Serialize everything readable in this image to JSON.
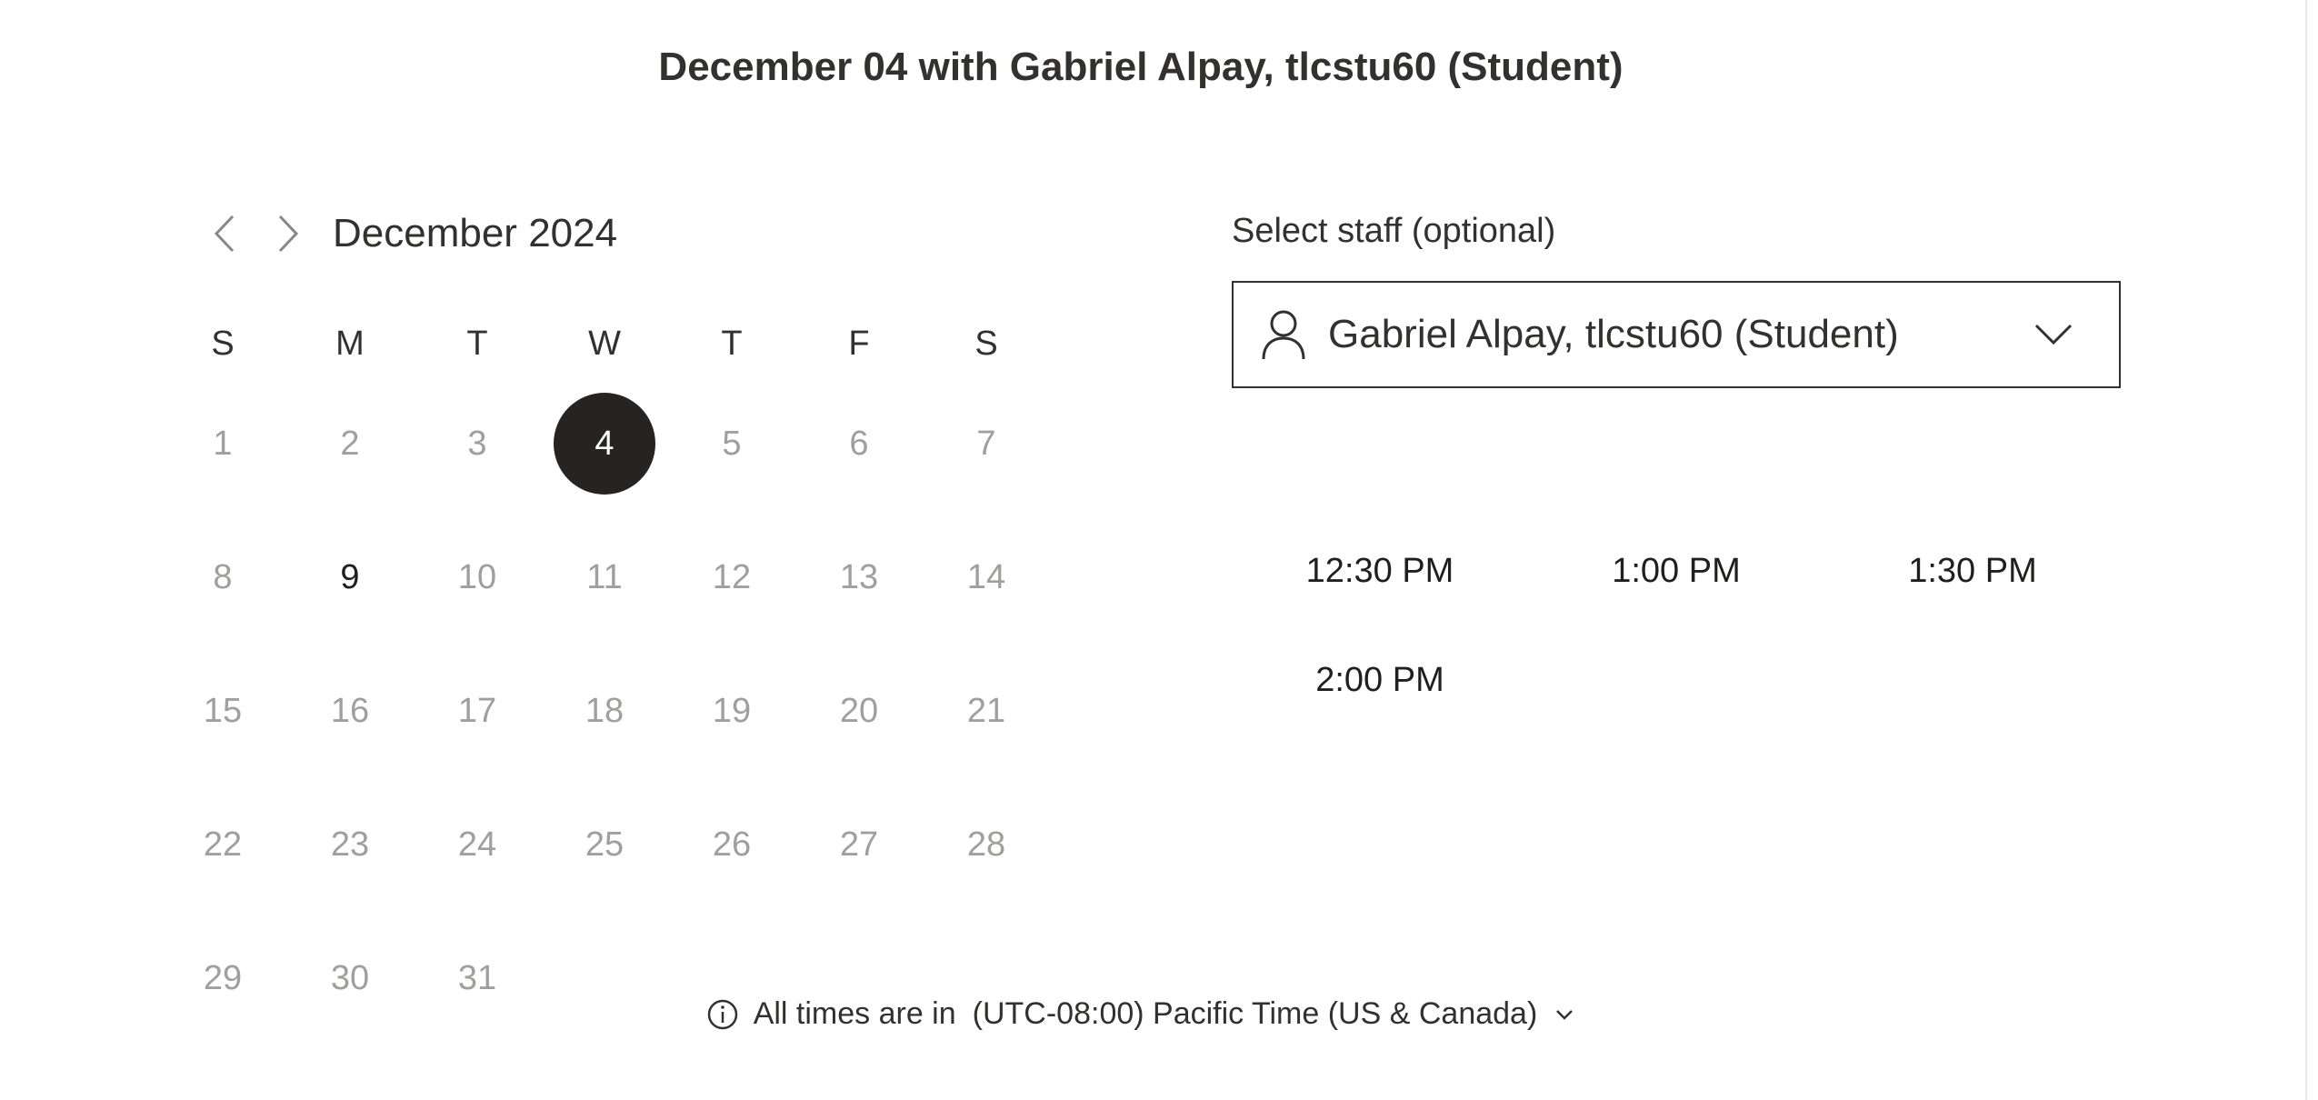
{
  "title": "December 04 with Gabriel Alpay, tlcstu60 (Student)",
  "calendar": {
    "month_label": "December 2024",
    "weekdays": [
      "S",
      "M",
      "T",
      "W",
      "T",
      "F",
      "S"
    ],
    "weeks": [
      [
        "1",
        "2",
        "3",
        "4",
        "5",
        "6",
        "7"
      ],
      [
        "8",
        "9",
        "10",
        "11",
        "12",
        "13",
        "14"
      ],
      [
        "15",
        "16",
        "17",
        "18",
        "19",
        "20",
        "21"
      ],
      [
        "22",
        "23",
        "24",
        "25",
        "26",
        "27",
        "28"
      ],
      [
        "29",
        "30",
        "31",
        "",
        "",
        "",
        ""
      ]
    ],
    "selected_day": "4",
    "available_days": [
      "9"
    ]
  },
  "staff": {
    "label": "Select staff (optional)",
    "selected": "Gabriel Alpay, tlcstu60 (Student)"
  },
  "slots": [
    "12:30 PM",
    "1:00 PM",
    "1:30 PM",
    "2:00 PM"
  ],
  "timezone": {
    "prefix": "All times are in",
    "value": "(UTC-08:00) Pacific Time (US & Canada)"
  },
  "icons": {
    "prev": "chevron-left-icon",
    "next": "chevron-right-icon",
    "person": "person-icon",
    "dropdown": "chevron-down-icon",
    "info": "info-icon"
  },
  "colors": {
    "selected_bg": "#252423",
    "disabled_text": "#a19f9d",
    "text": "#323130"
  }
}
